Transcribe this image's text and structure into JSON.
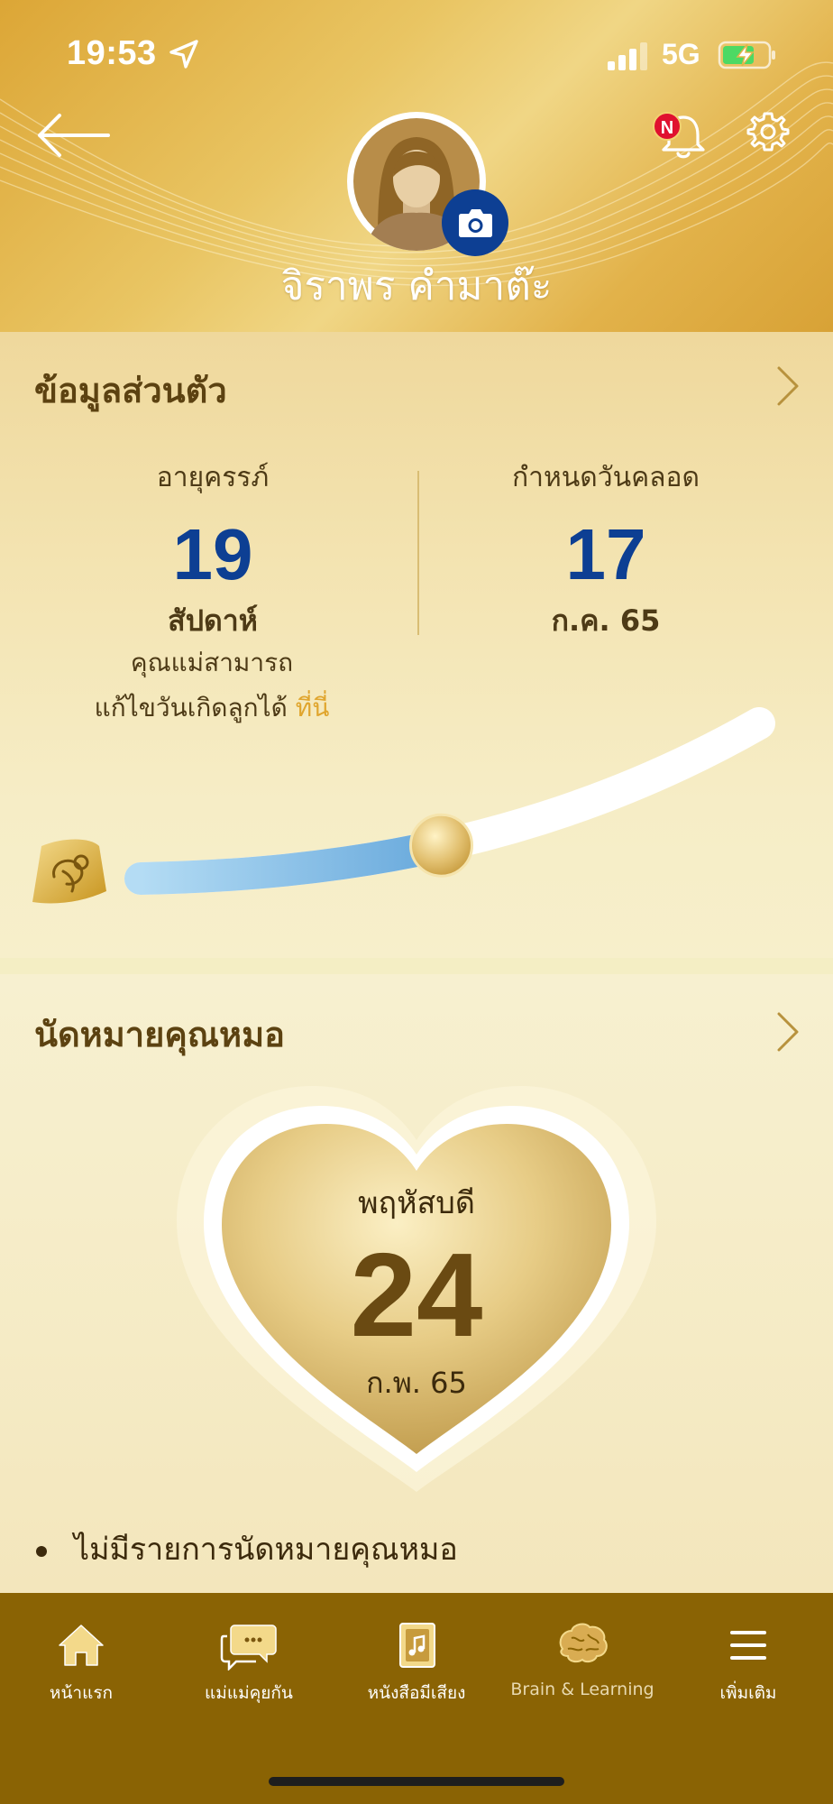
{
  "status_bar": {
    "time": "19:53",
    "network": "5G",
    "icons": [
      "location-arrow-icon",
      "signal-icon",
      "battery-charging-icon"
    ]
  },
  "header": {
    "user_name": "จิราพร คำมาต๊ะ",
    "notification_badge": "N",
    "icons": [
      "back-arrow-icon",
      "bell-icon",
      "gear-icon",
      "camera-icon"
    ]
  },
  "personal_info": {
    "title": "ข้อมูลส่วนตัว",
    "pregnancy_age": {
      "label": "อายุครรภ์",
      "value": "19",
      "unit": "สัปดาห์"
    },
    "due_date": {
      "label": "กำหนดวันคลอด",
      "day": "17",
      "month_year": "ก.ค. 65"
    },
    "note_line1": "คุณแม่สามารถ",
    "note_line2": "แก้ไขวันเกิดลูกได้",
    "note_link": "ที่นี่",
    "progress_fraction": 0.47
  },
  "appointment": {
    "title": "นัดหมายคุณหมอ",
    "day_name": "พฤหัสบดี",
    "day": "24",
    "month_year": "ก.พ. 65",
    "empty_message": "ไม่มีรายการนัดหมายคุณหมอ"
  },
  "nav": {
    "items": [
      {
        "label": "หน้าแรก",
        "icon": "home-icon"
      },
      {
        "label": "แม่แม่คุยกัน",
        "icon": "chat-icon"
      },
      {
        "label": "หนังสือมีเสียง",
        "icon": "audiobook-icon"
      },
      {
        "label": "Brain & Learning",
        "icon": "brain-icon"
      },
      {
        "label": "เพิ่มเติม",
        "icon": "menu-icon"
      }
    ]
  },
  "colors": {
    "header_gold": "#e3b54a",
    "accent_blue": "#0d3f93",
    "nav_bg": "#8a6304",
    "link_gold": "#e0a52d",
    "badge_red": "#e0102f"
  }
}
